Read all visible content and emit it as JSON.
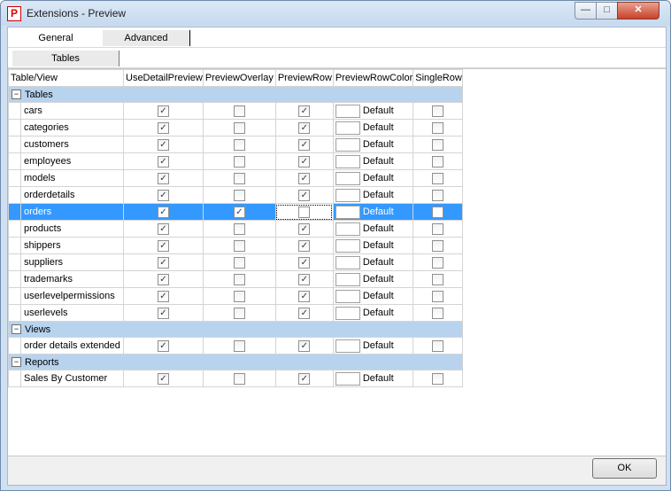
{
  "window": {
    "title": "Extensions - Preview",
    "app_icon": "P",
    "minimize": "—",
    "maximize": "□",
    "close": "✕"
  },
  "tabs": [
    {
      "label": "General"
    },
    {
      "label": "Advanced"
    }
  ],
  "subtabs": [
    {
      "label": "Tables"
    }
  ],
  "columns": [
    "Table/View",
    "UseDetailPreview",
    "PreviewOverlay",
    "PreviewRow",
    "PreviewRowColor",
    "SingleRow"
  ],
  "groups": [
    {
      "label": "Tables",
      "toggle": "−",
      "rows": [
        {
          "name": "cars",
          "detail": true,
          "overlay": false,
          "row": true,
          "color": "Default",
          "single": false
        },
        {
          "name": "categories",
          "detail": true,
          "overlay": false,
          "row": true,
          "color": "Default",
          "single": false
        },
        {
          "name": "customers",
          "detail": true,
          "overlay": false,
          "row": true,
          "color": "Default",
          "single": false
        },
        {
          "name": "employees",
          "detail": true,
          "overlay": false,
          "row": true,
          "color": "Default",
          "single": false
        },
        {
          "name": "models",
          "detail": true,
          "overlay": false,
          "row": true,
          "color": "Default",
          "single": false
        },
        {
          "name": "orderdetails",
          "detail": true,
          "overlay": false,
          "row": true,
          "color": "Default",
          "single": false
        },
        {
          "name": "orders",
          "detail": true,
          "overlay": true,
          "row": false,
          "color": "Default",
          "single": false,
          "selected": true
        },
        {
          "name": "products",
          "detail": true,
          "overlay": false,
          "row": true,
          "color": "Default",
          "single": false
        },
        {
          "name": "shippers",
          "detail": true,
          "overlay": false,
          "row": true,
          "color": "Default",
          "single": false
        },
        {
          "name": "suppliers",
          "detail": true,
          "overlay": false,
          "row": true,
          "color": "Default",
          "single": false
        },
        {
          "name": "trademarks",
          "detail": true,
          "overlay": false,
          "row": true,
          "color": "Default",
          "single": false
        },
        {
          "name": "userlevelpermissions",
          "detail": true,
          "overlay": false,
          "row": true,
          "color": "Default",
          "single": false
        },
        {
          "name": "userlevels",
          "detail": true,
          "overlay": false,
          "row": true,
          "color": "Default",
          "single": false
        }
      ]
    },
    {
      "label": "Views",
      "toggle": "−",
      "rows": [
        {
          "name": "order details extended",
          "detail": true,
          "overlay": false,
          "row": true,
          "color": "Default",
          "single": false
        }
      ]
    },
    {
      "label": "Reports",
      "toggle": "−",
      "rows": [
        {
          "name": "Sales By Customer",
          "detail": true,
          "overlay": false,
          "row": true,
          "color": "Default",
          "single": false
        }
      ]
    }
  ],
  "footer": {
    "ok_label": "OK"
  },
  "colors": {
    "selection": "#3399ff",
    "group_band": "#b8d3ee"
  }
}
